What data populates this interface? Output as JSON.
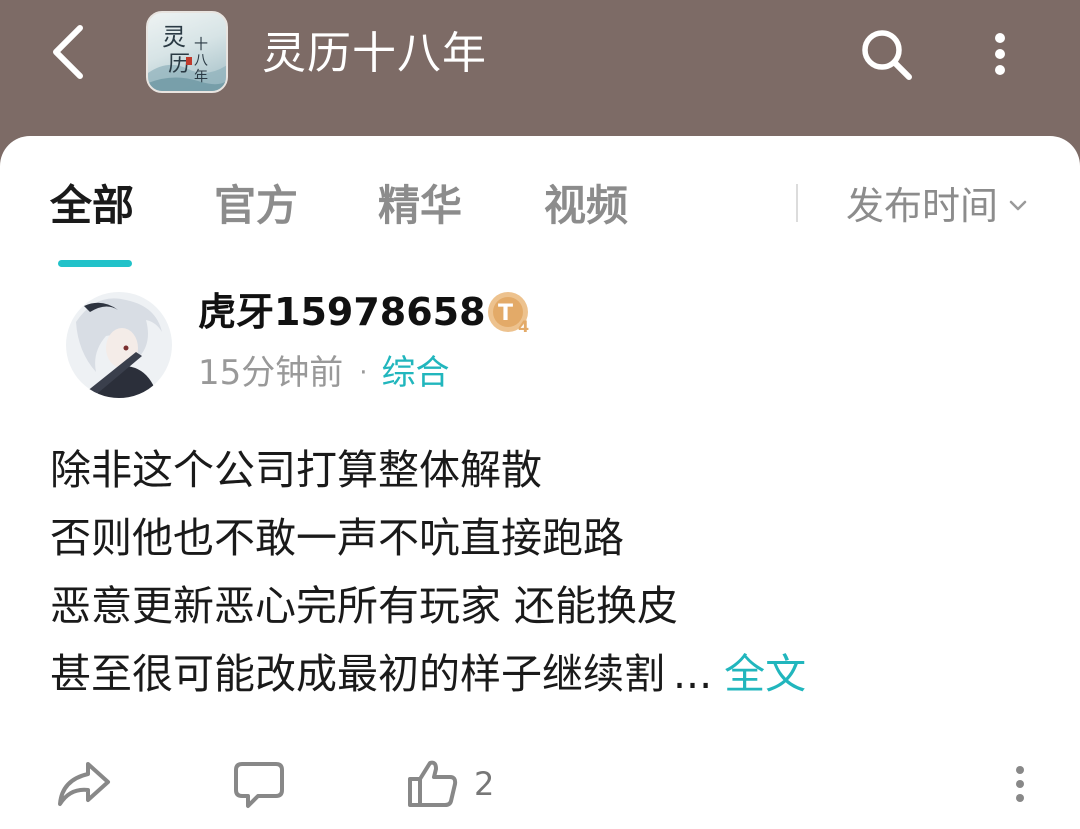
{
  "header": {
    "title": "灵历十八年",
    "app_icon_text": "灵历十八年"
  },
  "tabs": [
    {
      "label": "全部",
      "active": true
    },
    {
      "label": "官方",
      "active": false
    },
    {
      "label": "精华",
      "active": false
    },
    {
      "label": "视频",
      "active": false
    }
  ],
  "sort": {
    "label": "发布时间"
  },
  "post": {
    "username": "虎牙15978658",
    "level_badge": "T4",
    "time": "15分钟前",
    "separator": "·",
    "category": "综合",
    "lines": [
      "除非这个公司打算整体解散",
      "否则他也不敢一声不吭直接跑路",
      "恶意更新恶心完所有玩家 还能换皮",
      "甚至很可能改成最初的样子继续割"
    ],
    "ellipsis": "...",
    "read_more": "全文",
    "like_count": "2"
  },
  "colors": {
    "header_bg": "#7d6b66",
    "accent": "#21b6bd",
    "badge": "#e9b77c"
  },
  "icons": [
    "back-icon",
    "search-icon",
    "more-icon",
    "chevron-down-icon",
    "share-icon",
    "comment-icon",
    "like-icon",
    "more-options-icon"
  ]
}
